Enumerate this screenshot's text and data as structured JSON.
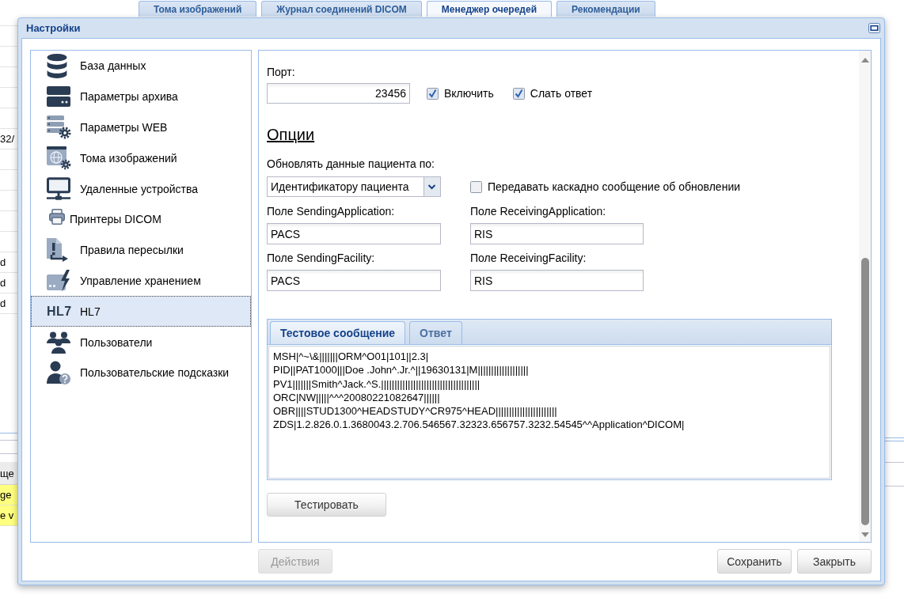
{
  "background": {
    "tabs": [
      {
        "label": "Тома изображений",
        "selected": false
      },
      {
        "label": "Журнал соединений DICOM",
        "selected": false
      },
      {
        "label": "Менеджер очередей",
        "selected": true
      },
      {
        "label": "Рекомендации",
        "selected": false
      }
    ],
    "grid_cells": [
      "32/",
      "d",
      "d",
      "d"
    ],
    "log_panel": {
      "header": "ще",
      "rows": [
        {
          "text": "ge",
          "highlighted": true
        },
        {
          "text": "e v",
          "highlighted": true
        }
      ]
    }
  },
  "dialog": {
    "title": "Настройки"
  },
  "sidebar": {
    "items": [
      {
        "label": "База данных",
        "selected": false
      },
      {
        "label": "Параметры архива",
        "selected": false
      },
      {
        "label": "Параметры WEB",
        "selected": false
      },
      {
        "label": "Тома изображений",
        "selected": false
      },
      {
        "label": "Удаленные устройства",
        "selected": false
      },
      {
        "label": "Принтеры DICOM",
        "selected": false
      },
      {
        "label": "Правила пересылки",
        "selected": false
      },
      {
        "label": "Управление хранением",
        "selected": false
      },
      {
        "label": "HL7",
        "icon_text": "HL7",
        "selected": true
      },
      {
        "label": "Пользователи",
        "selected": false
      },
      {
        "label": "Пользовательские подсказки",
        "selected": false
      }
    ]
  },
  "form": {
    "port": {
      "label": "Порт:",
      "value": "23456"
    },
    "checkboxes": [
      {
        "label": "Включить",
        "checked": true
      },
      {
        "label": "Слать ответ",
        "checked": true
      }
    ],
    "section_title": "Опции",
    "update_by": {
      "label": "Обновлять данные пациента по:",
      "value": "Идентификатору пациента"
    },
    "cascade": {
      "label": "Передавать каскадно сообщение об обновлении",
      "checked": false
    },
    "fields": [
      {
        "label": "Поле SendingApplication:",
        "value": "PACS"
      },
      {
        "label": "Поле ReceivingApplication:",
        "value": "RIS"
      },
      {
        "label": "Поле SendingFacility:",
        "value": "PACS"
      },
      {
        "label": "Поле ReceivingFacility:",
        "value": "RIS"
      }
    ]
  },
  "message_panel": {
    "tabs": [
      {
        "label": "Тестовое сообщение",
        "selected": true
      },
      {
        "label": "Ответ",
        "selected": false
      }
    ],
    "value": "MSH|^~\\&|||||||ORM^O01|101||2.3|\nPID||PAT1000|||Doe .John^.Jr.^||19630131|M|||||||||||||||||||\nPV1|||||||Smith^Jack.^S.|||||||||||||||||||||||||||||||||||||\nORC|NW|||||^^^20080221082647||||||\nOBR||||STUD1300^HEADSTUDY^CR975^HEAD|||||||||||||||||||||||\nZDS|1.2.826.0.1.3680043.2.706.546567.32323.656757.3232.54545^^Application^DICOM|"
  },
  "test_button": "Тестировать",
  "footer": {
    "buttons": [
      {
        "label": "Действия",
        "disabled": true
      },
      {
        "label": "Сохранить",
        "disabled": false
      },
      {
        "label": "Закрыть",
        "disabled": false
      }
    ]
  }
}
